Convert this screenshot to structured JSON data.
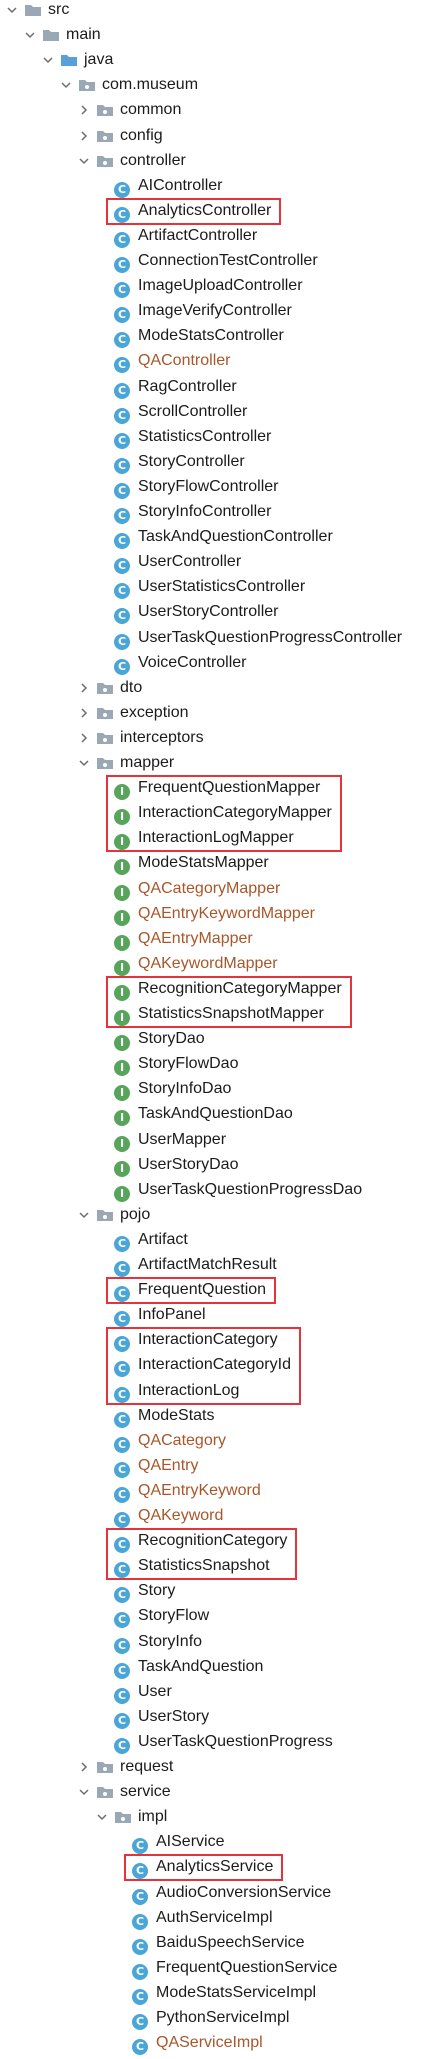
{
  "project_tree": {
    "nodes": [
      {
        "label": "src",
        "depth": 0,
        "kind": "folder",
        "expanded": true
      },
      {
        "label": "main",
        "depth": 1,
        "kind": "folder",
        "expanded": true
      },
      {
        "label": "java",
        "depth": 2,
        "kind": "source-folder",
        "expanded": true
      },
      {
        "label": "com.museum",
        "depth": 3,
        "kind": "package",
        "expanded": true
      },
      {
        "label": "common",
        "depth": 4,
        "kind": "package",
        "expanded": false
      },
      {
        "label": "config",
        "depth": 4,
        "kind": "package",
        "expanded": false
      },
      {
        "label": "controller",
        "depth": 4,
        "kind": "package",
        "expanded": true
      },
      {
        "label": "AIController",
        "depth": 5,
        "kind": "class"
      },
      {
        "label": "AnalyticsController",
        "depth": 5,
        "kind": "class",
        "highlighted": true
      },
      {
        "label": "ArtifactController",
        "depth": 5,
        "kind": "class"
      },
      {
        "label": "ConnectionTestController",
        "depth": 5,
        "kind": "class"
      },
      {
        "label": "ImageUploadController",
        "depth": 5,
        "kind": "class"
      },
      {
        "label": "ImageVerifyController",
        "depth": 5,
        "kind": "class"
      },
      {
        "label": "ModeStatsController",
        "depth": 5,
        "kind": "class"
      },
      {
        "label": "QAController",
        "depth": 5,
        "kind": "class",
        "modified": true
      },
      {
        "label": "RagController",
        "depth": 5,
        "kind": "class"
      },
      {
        "label": "ScrollController",
        "depth": 5,
        "kind": "class"
      },
      {
        "label": "StatisticsController",
        "depth": 5,
        "kind": "class"
      },
      {
        "label": "StoryController",
        "depth": 5,
        "kind": "class"
      },
      {
        "label": "StoryFlowController",
        "depth": 5,
        "kind": "class"
      },
      {
        "label": "StoryInfoController",
        "depth": 5,
        "kind": "class"
      },
      {
        "label": "TaskAndQuestionController",
        "depth": 5,
        "kind": "class"
      },
      {
        "label": "UserController",
        "depth": 5,
        "kind": "class"
      },
      {
        "label": "UserStatisticsController",
        "depth": 5,
        "kind": "class"
      },
      {
        "label": "UserStoryController",
        "depth": 5,
        "kind": "class"
      },
      {
        "label": "UserTaskQuestionProgressController",
        "depth": 5,
        "kind": "class"
      },
      {
        "label": "VoiceController",
        "depth": 5,
        "kind": "class"
      },
      {
        "label": "dto",
        "depth": 4,
        "kind": "package",
        "expanded": false
      },
      {
        "label": "exception",
        "depth": 4,
        "kind": "package",
        "expanded": false
      },
      {
        "label": "interceptors",
        "depth": 4,
        "kind": "package",
        "expanded": false
      },
      {
        "label": "mapper",
        "depth": 4,
        "kind": "package",
        "expanded": true
      },
      {
        "label": "FrequentQuestionMapper",
        "depth": 5,
        "kind": "interface",
        "highlighted": true
      },
      {
        "label": "InteractionCategoryMapper",
        "depth": 5,
        "kind": "interface",
        "highlighted": true
      },
      {
        "label": "InteractionLogMapper",
        "depth": 5,
        "kind": "interface",
        "highlighted": true
      },
      {
        "label": "ModeStatsMapper",
        "depth": 5,
        "kind": "interface"
      },
      {
        "label": "QACategoryMapper",
        "depth": 5,
        "kind": "interface",
        "modified": true
      },
      {
        "label": "QAEntryKeywordMapper",
        "depth": 5,
        "kind": "interface",
        "modified": true
      },
      {
        "label": "QAEntryMapper",
        "depth": 5,
        "kind": "interface",
        "modified": true
      },
      {
        "label": "QAKeywordMapper",
        "depth": 5,
        "kind": "interface",
        "modified": true
      },
      {
        "label": "RecognitionCategoryMapper",
        "depth": 5,
        "kind": "interface",
        "highlighted": true
      },
      {
        "label": "StatisticsSnapshotMapper",
        "depth": 5,
        "kind": "interface",
        "highlighted": true
      },
      {
        "label": "StoryDao",
        "depth": 5,
        "kind": "interface"
      },
      {
        "label": "StoryFlowDao",
        "depth": 5,
        "kind": "interface"
      },
      {
        "label": "StoryInfoDao",
        "depth": 5,
        "kind": "interface"
      },
      {
        "label": "TaskAndQuestionDao",
        "depth": 5,
        "kind": "interface"
      },
      {
        "label": "UserMapper",
        "depth": 5,
        "kind": "interface"
      },
      {
        "label": "UserStoryDao",
        "depth": 5,
        "kind": "interface"
      },
      {
        "label": "UserTaskQuestionProgressDao",
        "depth": 5,
        "kind": "interface"
      },
      {
        "label": "pojo",
        "depth": 4,
        "kind": "package",
        "expanded": true
      },
      {
        "label": "Artifact",
        "depth": 5,
        "kind": "class"
      },
      {
        "label": "ArtifactMatchResult",
        "depth": 5,
        "kind": "class"
      },
      {
        "label": "FrequentQuestion",
        "depth": 5,
        "kind": "class",
        "highlighted": true
      },
      {
        "label": "InfoPanel",
        "depth": 5,
        "kind": "class"
      },
      {
        "label": "InteractionCategory",
        "depth": 5,
        "kind": "class",
        "highlighted": true
      },
      {
        "label": "InteractionCategoryId",
        "depth": 5,
        "kind": "class",
        "highlighted": true
      },
      {
        "label": "InteractionLog",
        "depth": 5,
        "kind": "class",
        "highlighted": true
      },
      {
        "label": "ModeStats",
        "depth": 5,
        "kind": "class"
      },
      {
        "label": "QACategory",
        "depth": 5,
        "kind": "class",
        "modified": true
      },
      {
        "label": "QAEntry",
        "depth": 5,
        "kind": "class",
        "modified": true
      },
      {
        "label": "QAEntryKeyword",
        "depth": 5,
        "kind": "class",
        "modified": true
      },
      {
        "label": "QAKeyword",
        "depth": 5,
        "kind": "class",
        "modified": true
      },
      {
        "label": "RecognitionCategory",
        "depth": 5,
        "kind": "class",
        "highlighted": true
      },
      {
        "label": "StatisticsSnapshot",
        "depth": 5,
        "kind": "class",
        "highlighted": true
      },
      {
        "label": "Story",
        "depth": 5,
        "kind": "class"
      },
      {
        "label": "StoryFlow",
        "depth": 5,
        "kind": "class"
      },
      {
        "label": "StoryInfo",
        "depth": 5,
        "kind": "class"
      },
      {
        "label": "TaskAndQuestion",
        "depth": 5,
        "kind": "class"
      },
      {
        "label": "User",
        "depth": 5,
        "kind": "class"
      },
      {
        "label": "UserStory",
        "depth": 5,
        "kind": "class"
      },
      {
        "label": "UserTaskQuestionProgress",
        "depth": 5,
        "kind": "class"
      },
      {
        "label": "request",
        "depth": 4,
        "kind": "package",
        "expanded": false
      },
      {
        "label": "service",
        "depth": 4,
        "kind": "package",
        "expanded": true
      },
      {
        "label": "impl",
        "depth": 5,
        "kind": "package",
        "expanded": true
      },
      {
        "label": "AIService",
        "depth": 6,
        "kind": "class"
      },
      {
        "label": "AnalyticsService",
        "depth": 6,
        "kind": "class",
        "highlighted": true
      },
      {
        "label": "AudioConversionService",
        "depth": 6,
        "kind": "class"
      },
      {
        "label": "AuthServiceImpl",
        "depth": 6,
        "kind": "class"
      },
      {
        "label": "BaiduSpeechService",
        "depth": 6,
        "kind": "class"
      },
      {
        "label": "FrequentQuestionService",
        "depth": 6,
        "kind": "class"
      },
      {
        "label": "ModeStatsServiceImpl",
        "depth": 6,
        "kind": "class"
      },
      {
        "label": "PythonServiceImpl",
        "depth": 6,
        "kind": "class"
      },
      {
        "label": "QAServiceImpl",
        "depth": 6,
        "kind": "class",
        "modified": true
      }
    ],
    "colors": {
      "text": "#1b1b1b",
      "modified_text": "#a8562a",
      "folder": "#9aa7b4",
      "source_folder": "#5aa0d8",
      "class_badge": "#4aa6d6",
      "interface_badge": "#57a55a",
      "highlight_border": "#e5333b"
    },
    "badge_letters": {
      "class": "C",
      "interface": "I"
    }
  }
}
